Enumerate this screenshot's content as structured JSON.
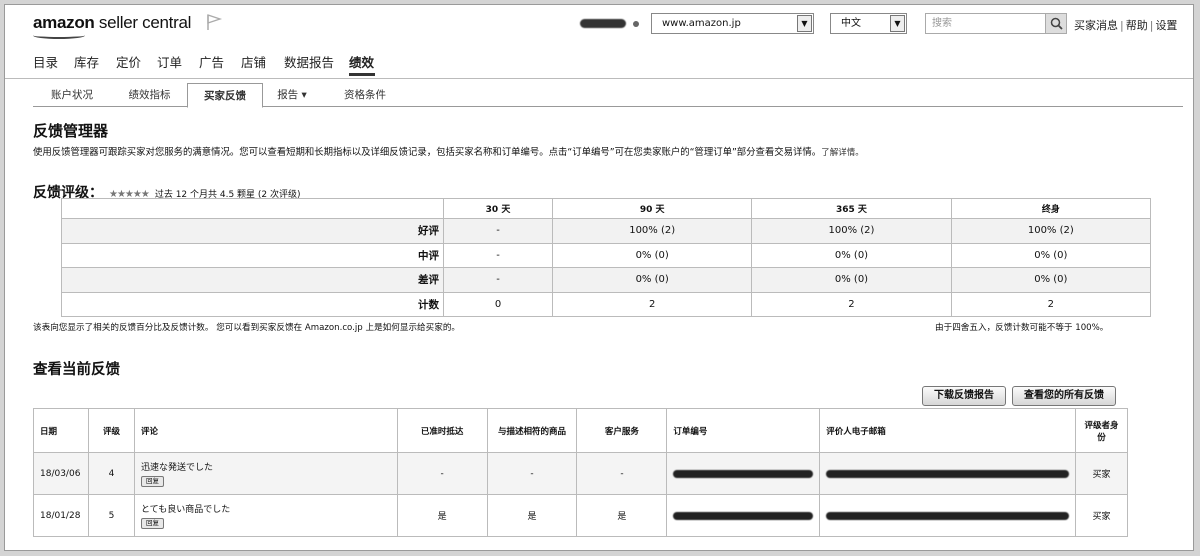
{
  "header": {
    "logo_bold": "amazon",
    "logo_rest": " seller central",
    "marketplace": "www.amazon.jp",
    "language": "中文",
    "search_placeholder": "搜索",
    "links": [
      "买家消息",
      "帮助",
      "设置"
    ]
  },
  "nav": [
    "目录",
    "库存",
    "定价",
    "订单",
    "广告",
    "店铺",
    "数据报告",
    "绩效"
  ],
  "subtabs": [
    "账户状况",
    "绩效指标",
    "买家反馈",
    "报告 ▾",
    "资格条件"
  ],
  "page": {
    "title": "反馈管理器",
    "description": "使用反馈管理器可跟踪买家对您服务的满意情况。您可以查看短期和长期指标以及详细反馈记录，包括买家名称和订单编号。点击“订单编号”可在您卖家账户的“管理订单”部分查看交易详情。",
    "learn_more": "了解详情。"
  },
  "rating": {
    "label": "反馈评级：",
    "stars": "★★★★★",
    "summary": "过去 12 个月共 4.5 颗星 (2 次评级)"
  },
  "summary_table": {
    "headers": [
      "30 天",
      "90 天",
      "365 天",
      "终身"
    ],
    "rows": [
      {
        "label": "好评",
        "values": [
          "-",
          "100% (2)",
          "100% (2)",
          "100% (2)"
        ]
      },
      {
        "label": "中评",
        "values": [
          "-",
          "0% (0)",
          "0% (0)",
          "0% (0)"
        ]
      },
      {
        "label": "差评",
        "values": [
          "-",
          "0% (0)",
          "0% (0)",
          "0% (0)"
        ]
      },
      {
        "label": "计数",
        "values": [
          "0",
          "2",
          "2",
          "2"
        ]
      }
    ],
    "note_left": "该表向您显示了相关的反馈百分比及反馈计数。 您可以看到买家反馈在 Amazon.co.jp 上是如何显示给买家的。",
    "note_right": "由于四舍五入，反馈计数可能不等于 100%。"
  },
  "current": {
    "title": "查看当前反馈",
    "download_btn": "下载反馈报告",
    "view_all_btn": "查看您的所有反馈",
    "headers": [
      "日期",
      "评级",
      "评论",
      "已准时抵达",
      "与描述相符的商品",
      "客户服务",
      "订单编号",
      "评价人电子邮箱",
      "评级者身份"
    ],
    "reply_label": "回复",
    "rows": [
      {
        "date": "18/03/06",
        "rating": "4",
        "comment": "迅速な発送でした",
        "on_time": "-",
        "as_described": "-",
        "service": "-",
        "role": "买家"
      },
      {
        "date": "18/01/28",
        "rating": "5",
        "comment": "とても良い商品でした",
        "on_time": "是",
        "as_described": "是",
        "service": "是",
        "role": "买家"
      }
    ]
  }
}
